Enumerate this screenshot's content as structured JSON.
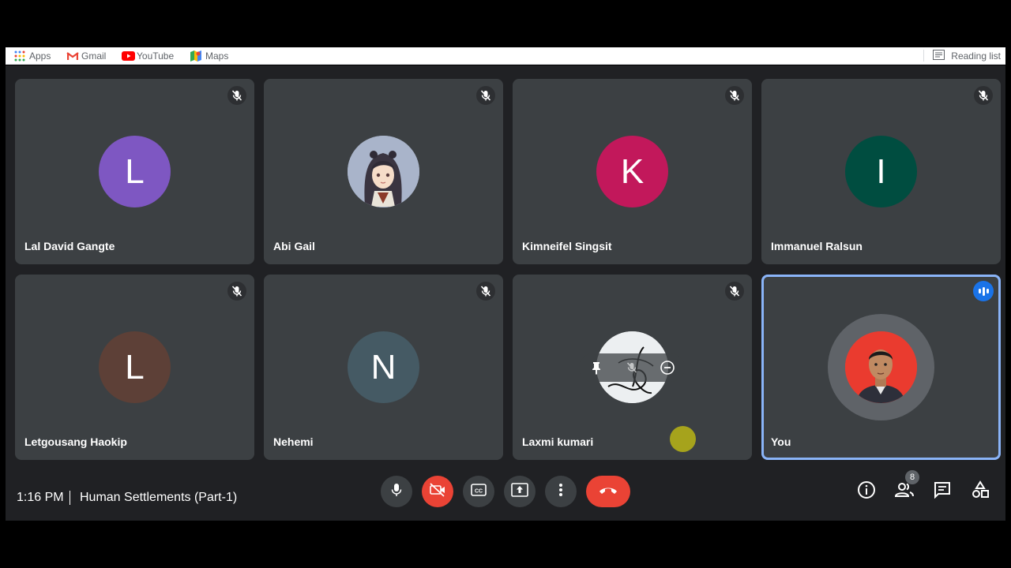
{
  "bookmarks_bar": {
    "items": [
      {
        "label": "Apps",
        "icon": "apps-grid-icon"
      },
      {
        "label": "Gmail",
        "icon": "gmail-icon"
      },
      {
        "label": "YouTube",
        "icon": "youtube-icon"
      },
      {
        "label": "Maps",
        "icon": "maps-icon"
      }
    ],
    "reading_list": "Reading list"
  },
  "participants": [
    {
      "name": "Lal David Gangte",
      "initial": "L",
      "color": "#7e57c2",
      "muted": true
    },
    {
      "name": "Abi Gail",
      "initial": "",
      "color": "#a7b2c8",
      "muted": true,
      "photo": "anime-girl-avatar"
    },
    {
      "name": "Kimneifel Singsit",
      "initial": "K",
      "color": "#c2185b",
      "muted": true
    },
    {
      "name": "Immanuel Ralsun",
      "initial": "I",
      "color": "#004d40",
      "muted": true
    },
    {
      "name": "Letgousang Haokip",
      "initial": "L",
      "color": "#5d4037",
      "muted": true
    },
    {
      "name": "Nehemi",
      "initial": "N",
      "color": "#455a64",
      "muted": true
    },
    {
      "name": "Laxmi kumari",
      "initial": "",
      "color": "#f1f3f4",
      "muted": true,
      "photo": "signature-avatar"
    },
    {
      "name": "You",
      "initial": "",
      "color": "#ea4335",
      "muted": false,
      "speaking": true,
      "photo": "self-avatar"
    }
  ],
  "bottom_bar": {
    "time": "1:16 PM",
    "meeting_title": "Human Settlements (Part-1)",
    "people_count": "8"
  },
  "colors": {
    "meet_background": "#202124",
    "tile_background": "#3c4043",
    "active_border": "#8ab4f8",
    "end_call": "#ea4335"
  }
}
